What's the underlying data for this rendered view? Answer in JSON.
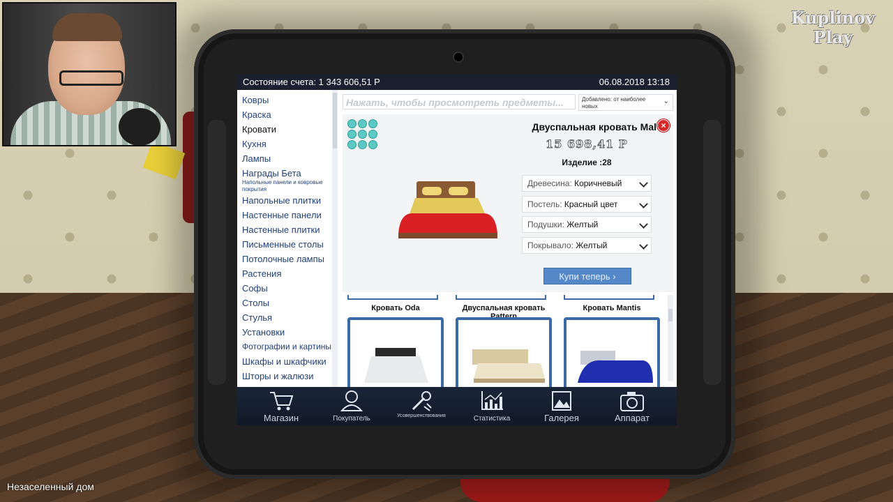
{
  "overlay": {
    "brand_line1": "Kuplinov",
    "brand_line2": "Play",
    "location": "Незаселенный дом"
  },
  "topbar": {
    "balance": "Состояние счета: 1 343 606,51 Р",
    "datetime": "06.08.2018 13:18"
  },
  "nav": {
    "items": [
      {
        "label": "Ковры"
      },
      {
        "label": "Краска"
      },
      {
        "label": "Кровати"
      },
      {
        "label": "Кухня"
      },
      {
        "label": "Лампы"
      },
      {
        "label": "Награды Бета"
      },
      {
        "label": "Напольные панели и ковровые покрытия"
      },
      {
        "label": "Напольные плитки"
      },
      {
        "label": "Настенные панели"
      },
      {
        "label": "Настенные плитки"
      },
      {
        "label": "Письменные столы"
      },
      {
        "label": "Потолочные лампы"
      },
      {
        "label": "Растения"
      },
      {
        "label": "Софы"
      },
      {
        "label": "Столы"
      },
      {
        "label": "Стулья"
      },
      {
        "label": "Установки"
      },
      {
        "label": "Фотографии и картины"
      },
      {
        "label": "Шкафы и шкафчики"
      },
      {
        "label": "Шторы и жалюзи"
      }
    ]
  },
  "search": {
    "placeholder": "Нажать, чтобы просмотреть предметы...",
    "sort_label": "Добавлено: от наиболее новых"
  },
  "detail": {
    "title": "Двуспальная кровать Mal",
    "price": "15 698,41 Р",
    "item_no": "Изделие :28",
    "options": [
      {
        "label": "Древесина:",
        "value": "Коричневый"
      },
      {
        "label": "Постель:",
        "value": "Красный цвет"
      },
      {
        "label": "Подушки:",
        "value": "Желтый"
      },
      {
        "label": "Покрывало:",
        "value": "Желтый"
      }
    ],
    "buy_label": "Купи теперь",
    "close_glyph": "×",
    "bed_colors": {
      "frame": "#8a5a33",
      "sheet": "#d81f24",
      "cover": "#e2c95a",
      "pillow": "#f0d878"
    }
  },
  "grid": {
    "cards": [
      {
        "title": "Кровать Oda"
      },
      {
        "title": "Двуспальная кровать Pattern"
      },
      {
        "title": "Кровать Mantis"
      }
    ]
  },
  "bottombar": {
    "items": [
      {
        "label": "Магазин",
        "icon": "cart-icon"
      },
      {
        "label": "Покупатель",
        "icon": "buyer-icon"
      },
      {
        "label": "Усовершенствования",
        "icon": "wrench-icon"
      },
      {
        "label": "Статистика",
        "icon": "stats-icon"
      },
      {
        "label": "Галерея",
        "icon": "gallery-icon"
      },
      {
        "label": "Аппарат",
        "icon": "camera-icon"
      }
    ]
  },
  "colors": {
    "accent": "#5488c8",
    "nav_text": "#22407a",
    "topbar": "#1a2030"
  }
}
